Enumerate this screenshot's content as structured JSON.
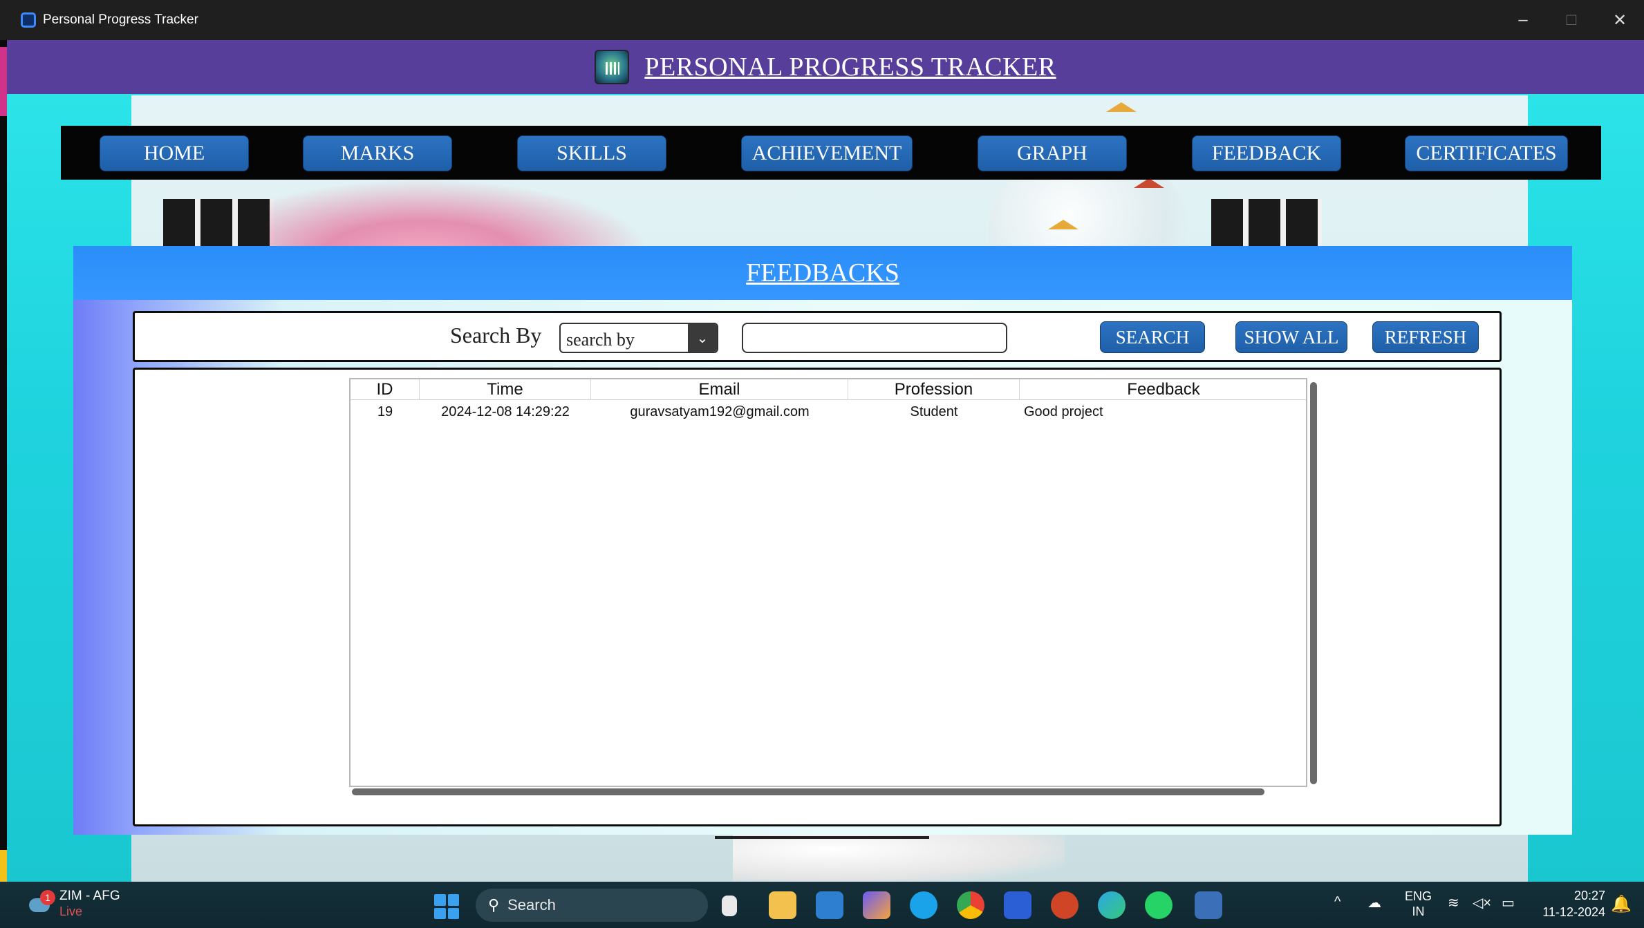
{
  "window": {
    "title": "Personal Progress Tracker",
    "controls": {
      "minimize": "–",
      "maximize": "□",
      "close": "✕"
    }
  },
  "header": {
    "title": "PERSONAL PROGRESS TRACKER",
    "logo_icon": "progress-chart-logo"
  },
  "nav": {
    "items": [
      {
        "label": "HOME"
      },
      {
        "label": "MARKS"
      },
      {
        "label": "SKILLS"
      },
      {
        "label": "ACHIEVEMENT"
      },
      {
        "label": "GRAPH"
      },
      {
        "label": "FEEDBACK"
      },
      {
        "label": "CERTIFICATES"
      }
    ]
  },
  "panel": {
    "title": "FEEDBACKS",
    "search": {
      "label": "Search By",
      "select_value": "search by",
      "input_value": "",
      "buttons": {
        "search": "SEARCH",
        "show_all": "SHOW ALL",
        "refresh": "REFRESH"
      }
    },
    "table": {
      "columns": [
        "ID",
        "Time",
        "Email",
        "Profession",
        "Feedback"
      ],
      "rows": [
        {
          "id": "19",
          "time": "2024-12-08 14:29:22",
          "email": "guravsatyam192@gmail.com",
          "profession": "Student",
          "feedback": "Good project"
        }
      ]
    }
  },
  "taskbar": {
    "weather": {
      "badge": "1",
      "label": "ZIM - AFG",
      "status": "Live"
    },
    "search_label": "Search",
    "language": {
      "line1": "ENG",
      "line2": "IN"
    },
    "clock": {
      "time": "20:27",
      "date": "11-12-2024"
    }
  },
  "colors": {
    "header_purple": "#563e9a",
    "nav_button_blue": "#1f5fa8",
    "panel_header_blue": "#2b8df7",
    "background_cyan": "#2ee6ea"
  }
}
